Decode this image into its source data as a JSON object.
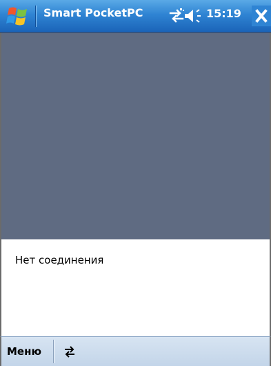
{
  "titlebar": {
    "title": "Smart PocketPC",
    "time": "15:19",
    "start_icon": "windows-flag-icon",
    "connectivity_icon": "connectivity-arrows-icon",
    "volume_icon": "speaker-volume-icon",
    "close_icon": "close-x-icon",
    "colors": {
      "bar_top": "#5aa9e6",
      "bar_bottom": "#1b64b8",
      "text": "#ffffff",
      "close_bg": "#2f84d3"
    }
  },
  "main": {
    "view_panel_color": "#5f6b82",
    "status_text": "Нет соединения"
  },
  "menubar": {
    "menu_label": "Меню",
    "sip_icon": "input-panel-arrows-icon",
    "colors": {
      "bar": "#c3d5e9"
    }
  }
}
